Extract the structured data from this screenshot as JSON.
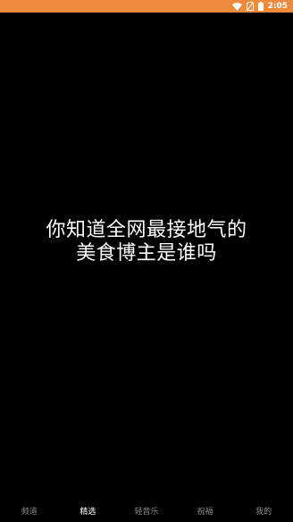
{
  "status_bar": {
    "background": "#f08a3c",
    "icons": [
      "wifi-icon",
      "no-sim-icon",
      "battery-icon"
    ],
    "time": "2:05"
  },
  "caption": {
    "line1": "你知道全网最接地气的",
    "line2": "美食博主是谁吗"
  },
  "bottom_nav": {
    "items": [
      {
        "label": "频道",
        "active": false
      },
      {
        "label": "精选",
        "active": true
      },
      {
        "label": "轻音乐",
        "active": false
      },
      {
        "label": "祝福",
        "active": false
      },
      {
        "label": "我的",
        "active": false
      }
    ]
  }
}
